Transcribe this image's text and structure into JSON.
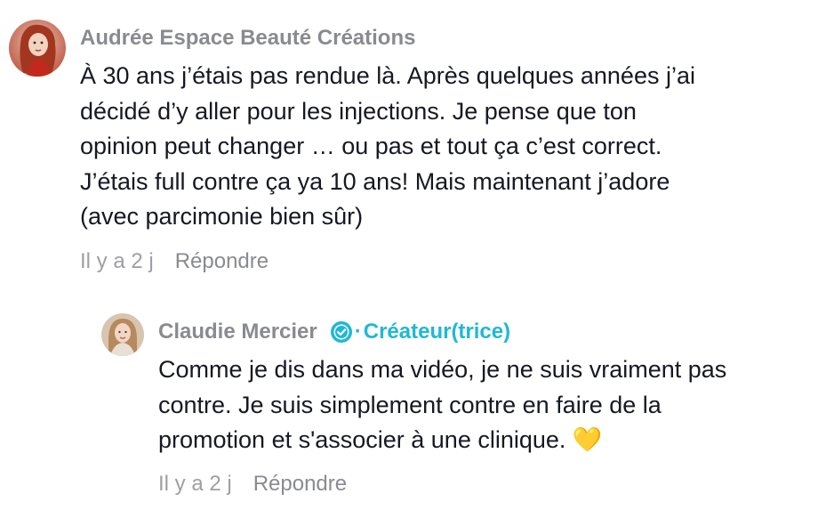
{
  "comments": [
    {
      "author": "Audrée Espace Beauté Créations",
      "lines": [
        "À 30 ans j’étais pas rendue là. Après quelques années j’ai",
        "décidé d’y aller pour les injections. Je pense que ton",
        "opinion peut changer … ou pas et tout ça c’est correct.",
        "J’étais full contre ça ya 10 ans! Mais maintenant j’adore",
        "(avec parcimonie bien sûr)"
      ],
      "time": "Il y a 2 j",
      "reply_label": "Répondre"
    }
  ],
  "replies": [
    {
      "author": "Claudie Mercier",
      "separator": "·",
      "creator_tag": "Créateur(trice)",
      "lines": [
        "Comme je dis dans ma vidéo, je ne suis vraiment pas",
        "contre. Je suis simplement contre en faire de la",
        "promotion et s'associer à une clinique. 💛"
      ],
      "time": "Il y a 2 j",
      "reply_label": "Répondre"
    }
  ],
  "colors": {
    "text": "#161823",
    "muted": "#8a8b91",
    "accent": "#20b8d5"
  },
  "icons": {
    "verified": "verified-badge-icon"
  }
}
